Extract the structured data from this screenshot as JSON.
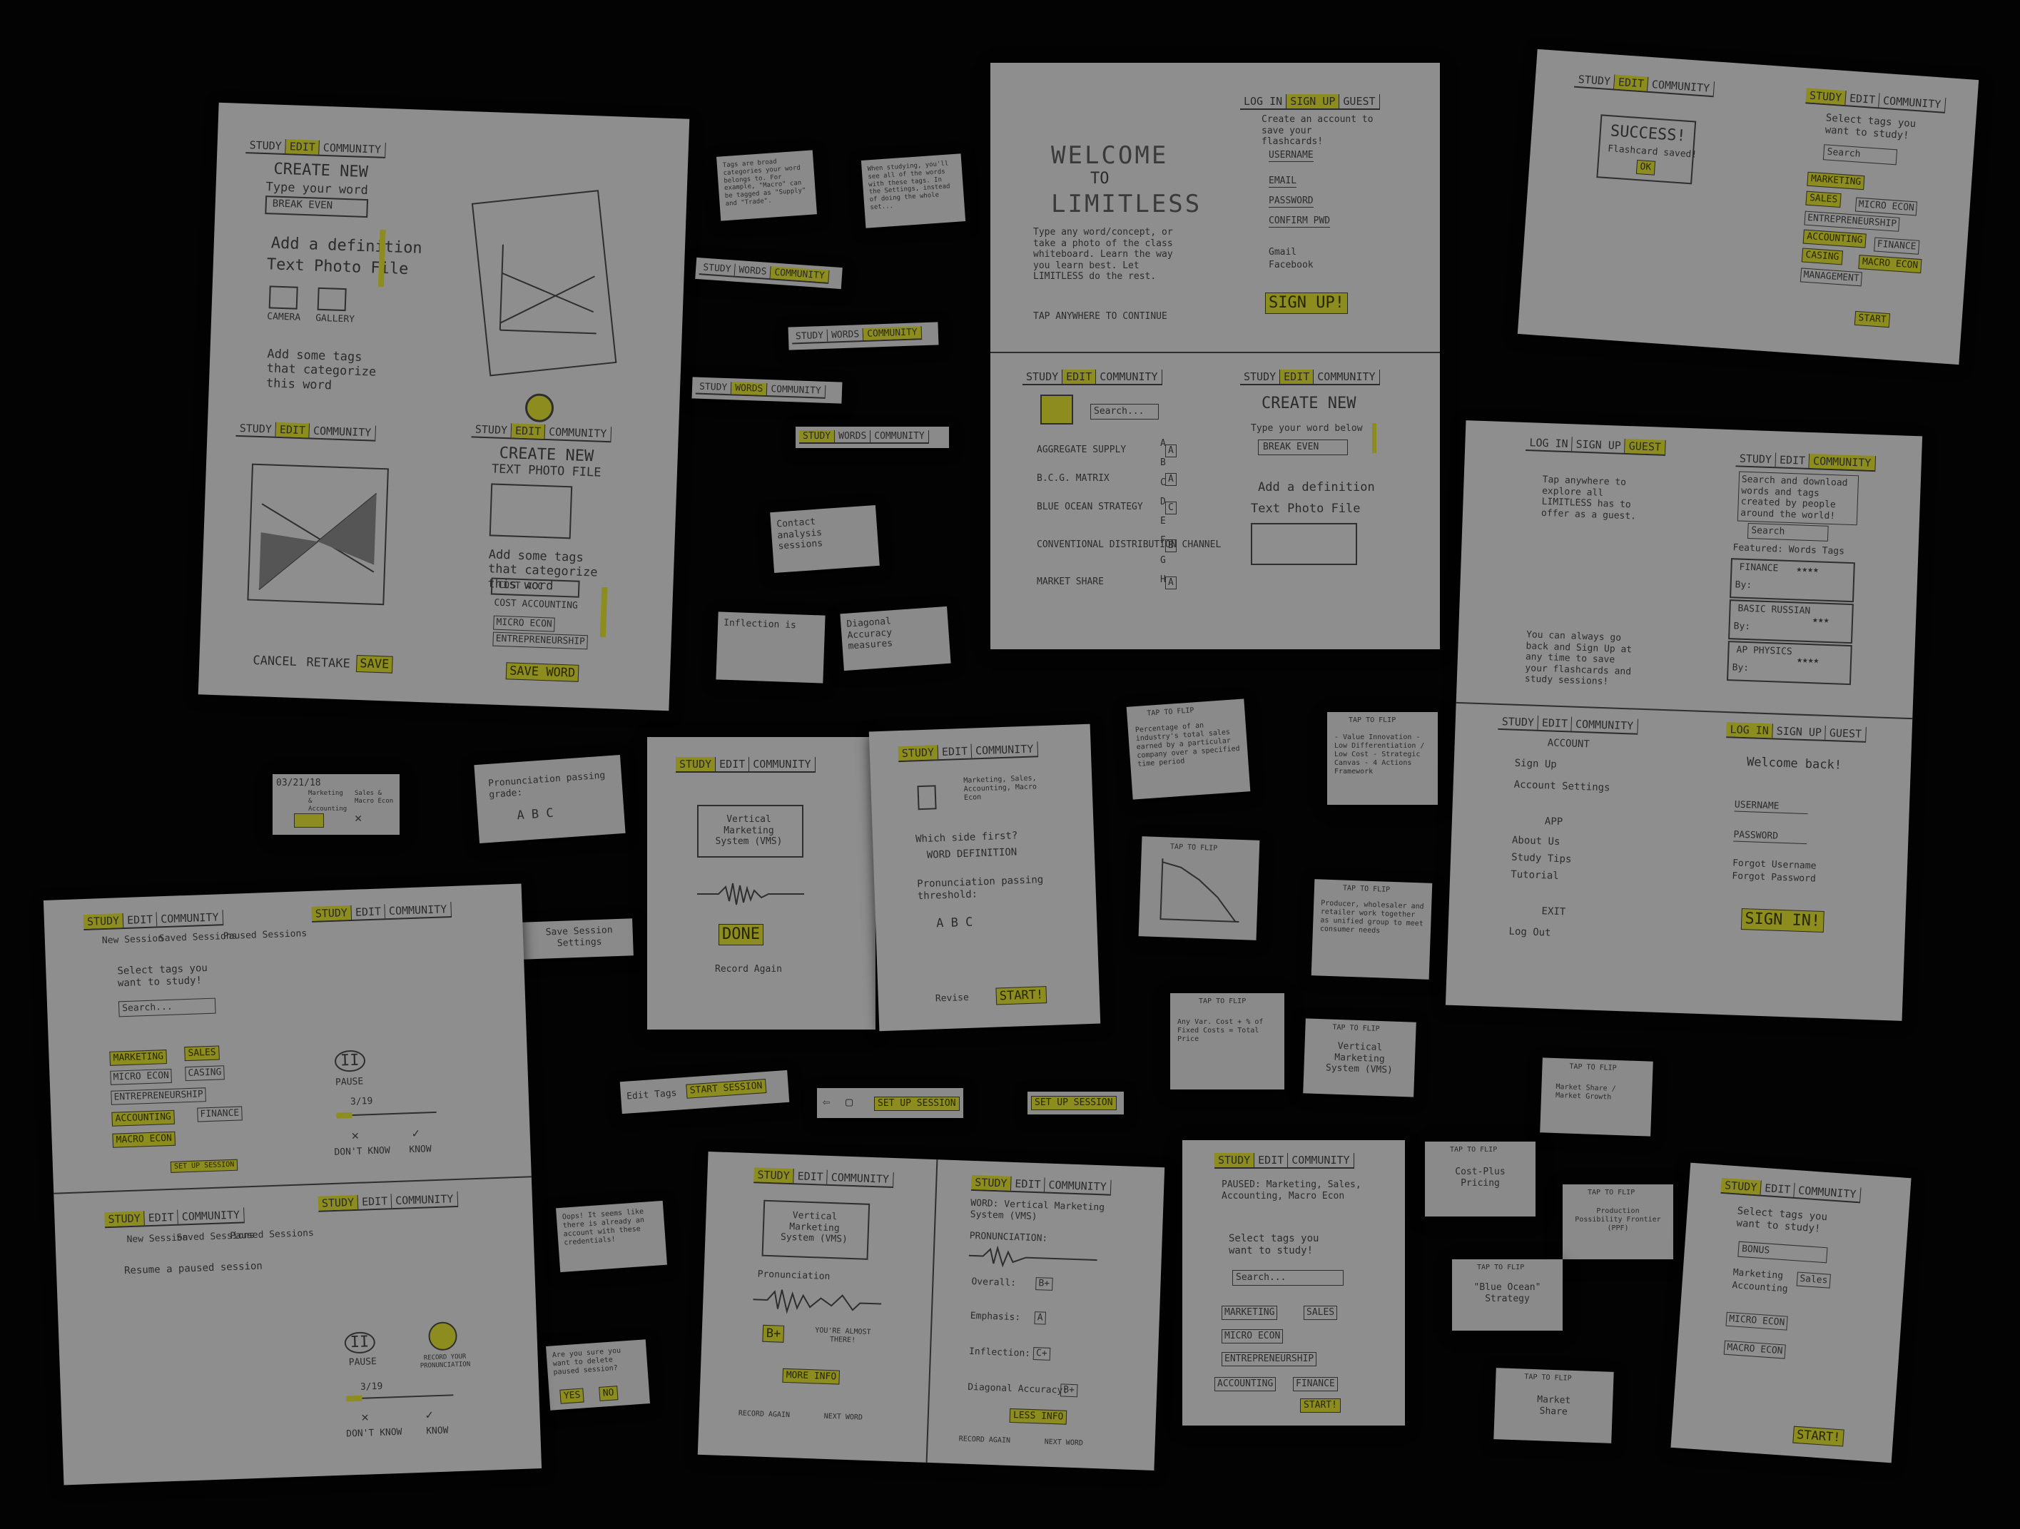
{
  "nav": {
    "study": "STUDY",
    "edit": "EDIT",
    "community": "COMMUNITY",
    "words": "WORDS"
  },
  "sheet1": {
    "create_new": "CREATE NEW",
    "type_word": "Type your word",
    "word_value": "BREAK EVEN",
    "add_definition": "Add a definition",
    "text_photo_file": "Text  Photo  File",
    "camera": "CAMERA",
    "gallery": "GALLERY",
    "add_tags": "Add some tags that categorize this word",
    "create_new2": "CREATE NEW",
    "text_photo_file2": "TEXT  PHOTO  FILE",
    "add_tags2": "Add some tags that categorize this word",
    "cost_acc": "COST ACC",
    "cost_accounting": "COST ACCOUNTING",
    "micro_econ": "MICRO ECON",
    "entrepreneurship": "ENTREPRENEURSHIP",
    "save_word": "SAVE WORD",
    "cancel": "CANCEL",
    "retake": "RETAKE",
    "save": "SAVE"
  },
  "notes": {
    "tags_tip": "Tags are broad categories your word belongs to. For example, \"Macro\" can be tagged as \"Supply\" and \"Trade\".",
    "tip2": "When studying, you'll see all of the words with these tags. In the Settings, instead of doing the whole set...",
    "contact_analysis": "Contact analysis sessions",
    "inflection": "Inflection is",
    "diagonal": "Diagonal Accuracy measures",
    "date": "03/21/18",
    "marketing_tag": "Marketing & Accounting",
    "sales_tag": "Sales & Macro Econ",
    "pronunciation_grade": "Pronunciation passing grade:",
    "abc": "A  B  C",
    "save_session": "Save Session Settings",
    "edit_tags": "Edit Tags",
    "start_session": "START SESSION",
    "set_up_session": "SET UP SESSION",
    "set_up_session2": "SET UP SESSION",
    "oops": "Oops! It seems like there is already an account with these credentials!",
    "delete_confirm": "Are you sure you want to delete paused session?",
    "yes": "YES",
    "no": "NO"
  },
  "welcome_sheet": {
    "log_in": "LOG IN",
    "sign_up": "SIGN UP",
    "guest": "GUEST",
    "welcome": "WELCOME",
    "to": "TO",
    "limitless": "LIMITLESS",
    "create_account": "Create an account to save your flashcards!",
    "username": "USERNAME",
    "email": "EMAIL",
    "password": "PASSWORD",
    "confirm_pwd": "CONFIRM PWD",
    "gmail": "Gmail",
    "facebook": "Facebook",
    "sign_up_btn": "SIGN UP!",
    "intro": "Type any word/concept, or take a photo of the class whiteboard. Learn the way you learn best. Let LIMITLESS do the rest.",
    "tap_continue": "TAP ANYWHERE TO CONTINUE",
    "search": "Search...",
    "words": [
      "AGGREGATE SUPPLY",
      "B.C.G. MATRIX",
      "BLUE OCEAN STRATEGY",
      "CONVENTIONAL DISTRIBUTION CHANNEL",
      "MARKET SHARE"
    ],
    "word_tags": [
      "A",
      "A",
      "C",
      "B",
      "A"
    ],
    "alphabet": "A B C D E F G H",
    "create_new": "CREATE NEW",
    "type_word": "Type your word below",
    "word_value": "BREAK EVEN",
    "add_definition": "Add a definition",
    "text_photo_file": "Text  Photo  File"
  },
  "success_sheet": {
    "success": "SUCCESS!",
    "flashcard_saved": "Flashcard saved!",
    "ok": "OK",
    "select_tags": "Select tags you want to study!",
    "search": "Search",
    "tags": [
      "MARKETING",
      "SALES",
      "MICRO ECON",
      "ENTREPRENEURSHIP",
      "ACCOUNTING",
      "FINANCE",
      "CASING",
      "MACRO ECON",
      "MANAGEMENT"
    ],
    "start": "START"
  },
  "guest_sheet": {
    "log_in": "LOG IN",
    "sign_up": "SIGN UP",
    "guest": "GUEST",
    "explore": "Tap anywhere to explore all LIMITLESS has to offer as a guest.",
    "search_download": "Search and download words and tags created by people around the world!",
    "search": "Search",
    "featured": "Featured: Words  Tags",
    "finance": "FINANCE",
    "basic_russian": "BASIC RUSSIAN",
    "ap_physics": "AP PHYSICS",
    "by": "By:",
    "go_back": "You can always go back and Sign Up at any time to save your flashcards and study sessions!",
    "account": "ACCOUNT",
    "sign_up_link": "Sign Up",
    "account_settings": "Account Settings",
    "app": "APP",
    "about_us": "About Us",
    "study_tips": "Study Tips",
    "tutorial": "Tutorial",
    "exit": "EXIT",
    "log_out": "Log Out",
    "welcome_back": "Welcome back!",
    "username": "USERNAME",
    "password": "PASSWORD",
    "forgot_username": "Forgot Username",
    "forgot_password": "Forgot Password",
    "sign_in": "SIGN IN!"
  },
  "vms_sheet": {
    "vms": "Vertical Marketing System (VMS)",
    "done": "DONE",
    "record_again": "Record Again",
    "tags_line": "Marketing, Sales, Accounting, Macro Econ",
    "which_side": "Which side first?",
    "word_def": "WORD  DEFINITION",
    "threshold": "Pronunciation passing threshold:",
    "abc": "A  B  C",
    "revise": "Revise",
    "start": "START!"
  },
  "flashcards": {
    "tap_to_flip": "TAP TO FLIP",
    "industry_sales": "Percentage of an industry's total sales earned by a particular company over a specified time period",
    "value_innovation": "- Value Innovation - Low Differentiation / Low Cost - Strategic Canvas - 4 Actions Framework",
    "prod_poss": "Production Possibility Frontier",
    "producer_wholesaler": "Producer, wholesaler and retailer work together as unified group to meet consumer needs",
    "cost_formula": "Any Var. Cost + % of Fixed Costs = Total Price",
    "vms": "Vertical Marketing System (VMS)",
    "matrix": "Market Share / Market Growth",
    "cost_plus": "Cost-Plus Pricing",
    "ppf": "Production Possibility Frontier (PPF)",
    "blue_ocean": "\"Blue Ocean\" Strategy",
    "market_share": "Market Share"
  },
  "session_sheet": {
    "new_session": "New Session",
    "saved_sessions": "Saved Sessions",
    "paused_sessions": "Paused Sessions",
    "select_tags": "Select tags you want to study!",
    "search": "Search...",
    "tags": [
      "MARKETING",
      "SALES",
      "MICRO ECON",
      "CASING",
      "ENTREPRENEURSHIP",
      "ACCOUNTING",
      "FINANCE",
      "MACRO ECON"
    ],
    "set_up": "SET UP SESSION",
    "pause": "PAUSE",
    "progress": "3/19",
    "dont_know": "DON'T KNOW",
    "know": "KNOW",
    "resume": "Resume a paused session",
    "record": "RECORD YOUR PRONUNCIATION"
  },
  "result_sheet": {
    "vms": "Vertical Marketing System (VMS)",
    "pronunciation": "Pronunciation",
    "grade": "B+",
    "almost": "YOU'RE ALMOST THERE!",
    "more_info": "MORE INFO",
    "record_again": "RECORD AGAIN",
    "next_word": "NEXT WORD",
    "word": "WORD: Vertical Marketing System (VMS)",
    "pron_heading": "PRONUNCIATION:",
    "overall": "Overall:",
    "emphasis": "Emphasis:",
    "inflection": "Inflection:",
    "diagonal": "Diagonal Accuracy:",
    "less_info": "LESS INFO",
    "g1": "B+",
    "g2": "A",
    "g3": "C+",
    "g4": "B+"
  },
  "paused_sheet": {
    "paused": "PAUSED: Marketing, Sales, Accounting, Macro Econ",
    "select_tags": "Select tags you want to study!",
    "search": "Search...",
    "tags": [
      "MARKETING",
      "SALES",
      "MICRO ECON",
      "ENTREPRENEURSHIP",
      "ACCOUNTING",
      "FINANCE"
    ],
    "start": "START!"
  },
  "last_sheet": {
    "select_tags": "Select tags you want to study!",
    "search": "BONUS",
    "tags": [
      "Marketing",
      "Sales",
      "Accounting",
      "MICRO ECON",
      "MACRO ECON"
    ],
    "start": "START!"
  },
  "chart_data": [
    {
      "type": "line",
      "series": [
        {
          "values": [
            120,
            110,
            85,
            50,
            0
          ]
        }
      ]
    }
  ]
}
